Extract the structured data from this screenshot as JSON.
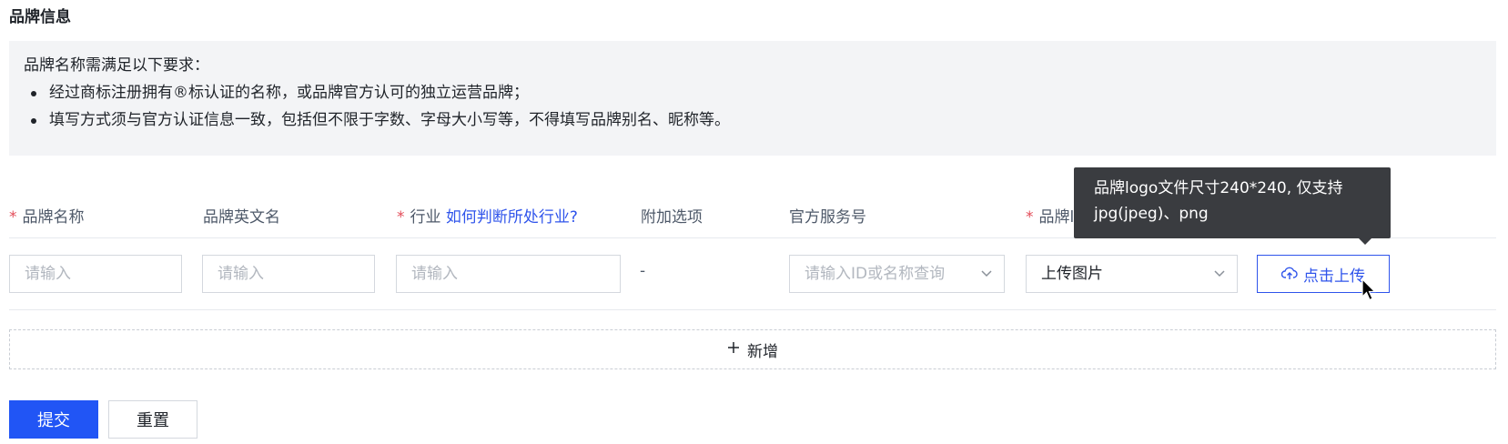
{
  "section": {
    "title": "品牌信息"
  },
  "notice": {
    "intro": "品牌名称需满足以下要求：",
    "items": [
      "经过商标注册拥有®标认证的名称，或品牌官方认可的独立运营品牌；",
      "填写方式须与官方认证信息一致，包括但不限于字数、字母大小写等，不得填写品牌别名、昵称等。"
    ]
  },
  "columns": {
    "brand_name": "品牌名称",
    "brand_en_name": "品牌英文名",
    "industry": "行业",
    "industry_link": "如何判断所处行业?",
    "extra_options": "附加选项",
    "official_account": "官方服务号",
    "brand_logo": "品牌logo"
  },
  "row": {
    "brand_name_placeholder": "请输入",
    "brand_en_name_placeholder": "请输入",
    "industry_placeholder": "请输入",
    "extra_options_value": "-",
    "official_account_placeholder": "请输入ID或名称查询",
    "logo_select_value": "上传图片",
    "upload_button": "点击上传"
  },
  "tooltip": {
    "text": "品牌logo文件尺寸240*240, 仅支持jpg(jpeg)、png"
  },
  "add_row": {
    "label": "新增"
  },
  "actions": {
    "submit": "提交",
    "reset": "重置"
  },
  "colors": {
    "primary": "#2155f5",
    "link": "#2f54eb",
    "required": "#e34d59",
    "tooltip_bg": "#3a3c40"
  },
  "icons": {
    "upload": "cloud-upload-icon",
    "add": "plus-icon",
    "select": "chevron-down-icon",
    "pointer": "mouse-cursor-icon"
  }
}
